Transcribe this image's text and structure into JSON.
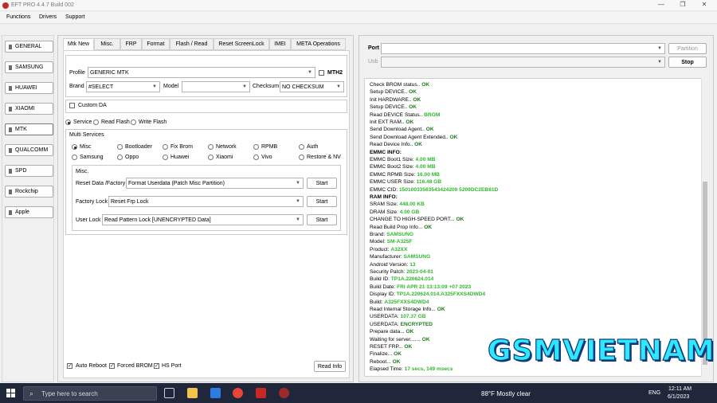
{
  "window": {
    "title": "EFT PRO 4.4.7 Build 002"
  },
  "menu": [
    "Functions",
    "Drivers",
    "Support"
  ],
  "nav": [
    "GENERAL",
    "SAMSUNG",
    "HUAWEI",
    "XIAOMI",
    "MTK",
    "QUALCOMM",
    "SPD",
    "Rockchip",
    "Apple"
  ],
  "tabs": [
    "Mtk New",
    "Misc.",
    "FRP",
    "Format",
    "Flash / Read",
    "Reset ScreenLock",
    "IMEI",
    "META Operations"
  ],
  "profile": {
    "label": "Profile",
    "value": "GENERIC MTK",
    "mth2": "MTH2"
  },
  "brand": {
    "label": "Brand",
    "value": "#SELECT"
  },
  "model": {
    "label": "Model",
    "value": ""
  },
  "checksum": {
    "label": "Checksum",
    "value": "NO CHECKSUM"
  },
  "custom_da": "Custom DA",
  "modes": [
    "Service",
    "Read Flash",
    "Write Flash"
  ],
  "multi": {
    "title": "Multi Services",
    "row1": [
      "Misc",
      "Bootloader",
      "Fix Brom",
      "Network",
      "RPMB",
      "Auth"
    ],
    "row2": [
      "Samsung",
      "Oppo",
      "Huawei",
      "Xiaomi",
      "Vivo",
      "Restore & NV"
    ]
  },
  "misc": {
    "title": "Misc.",
    "rows": [
      {
        "label": "Reset Data /Factory",
        "value": "Format Userdata (Patch Misc Partition)",
        "button": "Start"
      },
      {
        "label": "Factory Lock",
        "value": "Reset Frp Lock",
        "button": "Start"
      },
      {
        "label": "User Lock",
        "value": "Read Pattern Lock [UNENCRYPTED Data]",
        "button": "Start"
      }
    ]
  },
  "bottom": {
    "auto_reboot": "Auto Reboot",
    "forced_brom": "Forced BROM",
    "hs_port": "HS Port",
    "read_info": "Read Info"
  },
  "port": {
    "label": "Port",
    "partition": "Partition",
    "usb_label": "Usb",
    "stop": "Stop"
  },
  "log": [
    {
      "t": "Check BROM status.. ",
      "v": "OK",
      "c": "ok"
    },
    {
      "t": "Setup DEVICE.. ",
      "v": "OK",
      "c": "ok"
    },
    {
      "t": "Init HARDWARE.. ",
      "v": "OK",
      "c": "ok"
    },
    {
      "t": "Setup DEVICE.. ",
      "v": "OK",
      "c": "ok"
    },
    {
      "t": "Read DEVICE Status.. ",
      "v": "BROM",
      "c": "val"
    },
    {
      "t": "Init EXT RAM.. ",
      "v": "OK",
      "c": "ok"
    },
    {
      "t": "Send Download Agent.. ",
      "v": "OK",
      "c": "ok"
    },
    {
      "t": "Send Download Agent Extended.. ",
      "v": "OK",
      "c": "ok"
    },
    {
      "t": "Read Device Info.. ",
      "v": "OK",
      "c": "ok"
    },
    {
      "t": "EMMC INFO:",
      "v": "",
      "c": "hdr"
    },
    {
      "t": "EMMC Boot1 Size: ",
      "v": "4.00 MB",
      "c": "val"
    },
    {
      "t": "EMMC Boot2 Size: ",
      "v": "4.00 MB",
      "c": "val"
    },
    {
      "t": "EMMC RPMB Size: ",
      "v": "16.00 MB",
      "c": "val"
    },
    {
      "t": "EMMC USER Size: ",
      "v": "116.48 GB",
      "c": "val"
    },
    {
      "t": "EMMC CID: ",
      "v": "15010033563543424200 5209DC2EB81D",
      "c": "val"
    },
    {
      "t": "RAM INFO:",
      "v": "",
      "c": "hdr"
    },
    {
      "t": "SRAM Size: ",
      "v": "448.00 KB",
      "c": "val"
    },
    {
      "t": "DRAM Size: ",
      "v": "4.00 GB",
      "c": "val"
    },
    {
      "t": "CHANGE TO HIGH-SPEED PORT... ",
      "v": "OK",
      "c": "ok"
    },
    {
      "t": "Read Build Prop Info... ",
      "v": "OK",
      "c": "ok"
    },
    {
      "t": " Brand: ",
      "v": "SAMSUNG",
      "c": "val"
    },
    {
      "t": " Model: ",
      "v": "SM-A325F",
      "c": "val"
    },
    {
      "t": " Product: ",
      "v": "A32XX",
      "c": "val"
    },
    {
      "t": " Manufacturer: ",
      "v": "SAMSUNG",
      "c": "val"
    },
    {
      "t": " Android Version: ",
      "v": "13",
      "c": "val"
    },
    {
      "t": " Security Patch: ",
      "v": "2023-04-01",
      "c": "val"
    },
    {
      "t": " Build ID: ",
      "v": "TP1A.220624.014",
      "c": "val"
    },
    {
      "t": " Build Date: ",
      "v": "FRI APR 21 13:13:09 +07 2023",
      "c": "val"
    },
    {
      "t": " Display ID: ",
      "v": "TP1A.220624.014.A325FXXS4DWD4",
      "c": "val"
    },
    {
      "t": " Build: ",
      "v": "A325FXXS4DWD4",
      "c": "val"
    },
    {
      "t": "Read Internal Storage Info... ",
      "v": "OK",
      "c": "ok"
    },
    {
      "t": "USERDATA: ",
      "v": "107.37 GB",
      "c": "val"
    },
    {
      "t": "USERDATA: ",
      "v": "ENCRYPTED",
      "c": "ok"
    },
    {
      "t": "Prepare data... ",
      "v": "OK",
      "c": "ok"
    },
    {
      "t": "Waiting for server....... ",
      "v": "OK",
      "c": "ok"
    },
    {
      "t": "RESET FRP... ",
      "v": "OK",
      "c": "ok"
    },
    {
      "t": "Finalize... ",
      "v": "OK",
      "c": "ok"
    },
    {
      "t": "Reboot... ",
      "v": "OK",
      "c": "ok"
    },
    {
      "t": "Elapsed Time: ",
      "v": "17 secs, 149 msecs",
      "c": "val"
    }
  ],
  "watermark": "GSMVIETNAM",
  "taskbar": {
    "search": "Type here to search",
    "weather": "88°F  Mostly clear",
    "lang": "ENG",
    "time": "12:11 AM",
    "date": "6/1/2023"
  }
}
